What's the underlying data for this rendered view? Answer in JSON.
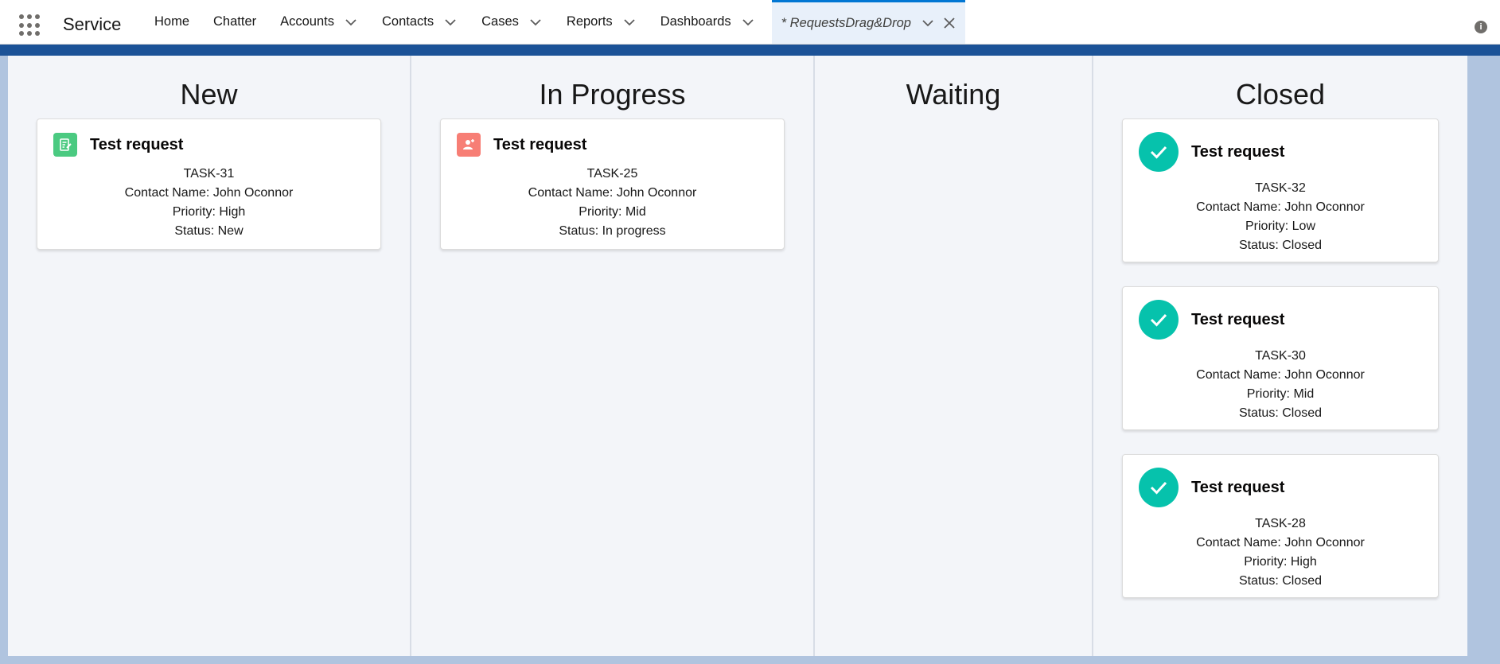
{
  "header": {
    "app_name": "Service",
    "nav": [
      {
        "label": "Home",
        "has_menu": false
      },
      {
        "label": "Chatter",
        "has_menu": false
      },
      {
        "label": "Accounts",
        "has_menu": true
      },
      {
        "label": "Contacts",
        "has_menu": true
      },
      {
        "label": "Cases",
        "has_menu": true
      },
      {
        "label": "Reports",
        "has_menu": true
      },
      {
        "label": "Dashboards",
        "has_menu": true
      }
    ],
    "active_tab": {
      "label": "* RequestsDrag&Drop"
    },
    "info_icon": "i"
  },
  "columns": [
    {
      "title": "New",
      "cards": [
        {
          "title": "Test request",
          "icon": "task-icon",
          "icon_color": "#4bca81",
          "task": "TASK-31",
          "contact": "Contact Name: John Oconnor",
          "priority": "Priority: High",
          "status": "Status: New"
        }
      ]
    },
    {
      "title": "In Progress",
      "cards": [
        {
          "title": "Test request",
          "icon": "contact-icon",
          "icon_color": "#f77e75",
          "task": "TASK-25",
          "contact": "Contact Name: John Oconnor",
          "priority": "Priority: Mid",
          "status": "Status: In progress"
        }
      ]
    },
    {
      "title": "Waiting",
      "cards": []
    },
    {
      "title": "Closed",
      "cards": [
        {
          "title": "Test request",
          "icon": "check-icon",
          "icon_color": "#06c2ac",
          "task": "TASK-32",
          "contact": "Contact Name: John Oconnor",
          "priority": "Priority: Low",
          "status": "Status: Closed"
        },
        {
          "title": "Test request",
          "icon": "check-icon",
          "icon_color": "#06c2ac",
          "task": "TASK-30",
          "contact": "Contact Name: John Oconnor",
          "priority": "Priority: Mid",
          "status": "Status: Closed"
        },
        {
          "title": "Test request",
          "icon": "check-icon",
          "icon_color": "#06c2ac",
          "task": "TASK-28",
          "contact": "Contact Name: John Oconnor",
          "priority": "Priority: High",
          "status": "Status: Closed"
        }
      ]
    }
  ]
}
